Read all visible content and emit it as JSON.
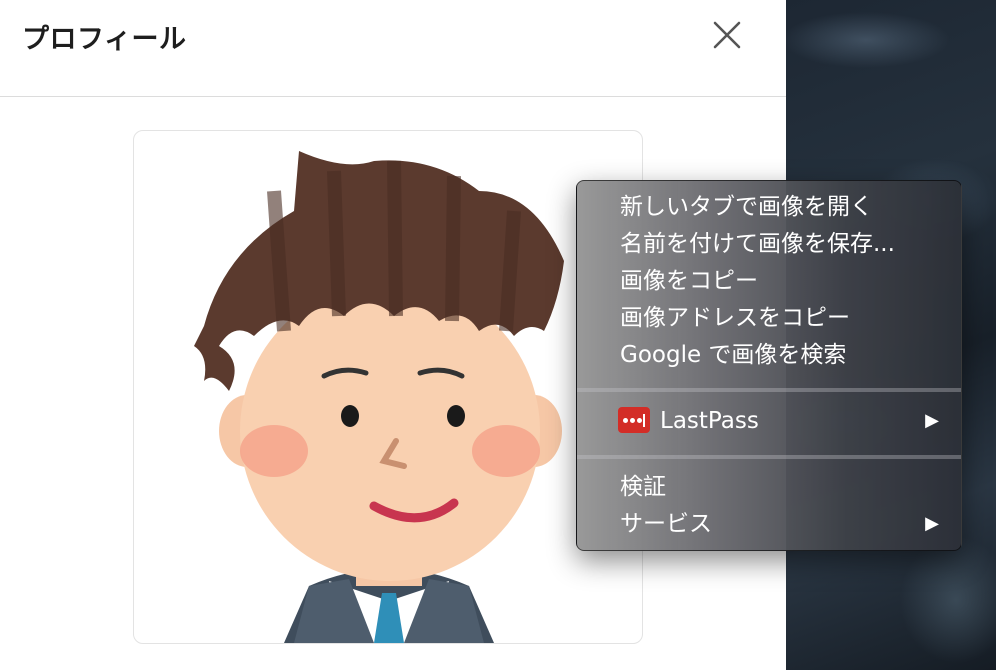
{
  "modal": {
    "title": "プロフィール",
    "close_icon": "close-icon"
  },
  "avatar": {
    "icon": "illustrated-man-avatar"
  },
  "context_menu": {
    "items": [
      {
        "label": "新しいタブで画像を開く"
      },
      {
        "label": "名前を付けて画像を保存..."
      },
      {
        "label": "画像をコピー"
      },
      {
        "label": "画像アドレスをコピー"
      },
      {
        "label": "Google で画像を検索"
      }
    ],
    "extension": {
      "label": "LastPass",
      "icon": "lastpass-icon",
      "has_submenu": true
    },
    "bottom_items": [
      {
        "label": "検証"
      },
      {
        "label": "サービス",
        "has_submenu": true
      }
    ],
    "submenu_arrow": "▶"
  },
  "colors": {
    "menu_text": "#ffffff",
    "lastpass_red": "#d32d27",
    "title_text": "#1e1e1e"
  }
}
